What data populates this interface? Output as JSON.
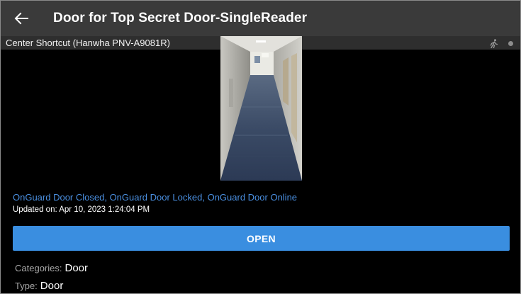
{
  "header": {
    "title": "Door for Top Secret Door-SingleReader"
  },
  "camera": {
    "name": "Center Shortcut (Hanwha PNV-A9081R)",
    "icons": [
      "walking-person-icon",
      "status-dot-icon"
    ]
  },
  "door": {
    "status": "OnGuard Door Closed, OnGuard Door Locked, OnGuard Door Online",
    "updated": "Updated on: Apr 10, 2023 1:24:04 PM",
    "open_label": "OPEN",
    "properties": [
      {
        "label": "Categories:",
        "value": "Door"
      },
      {
        "label": "Type:",
        "value": "Door"
      }
    ]
  },
  "colors": {
    "appbar": "#3a3a3a",
    "accent": "#3a8ee0",
    "status_text": "#4a8fe0",
    "background": "#000000"
  }
}
